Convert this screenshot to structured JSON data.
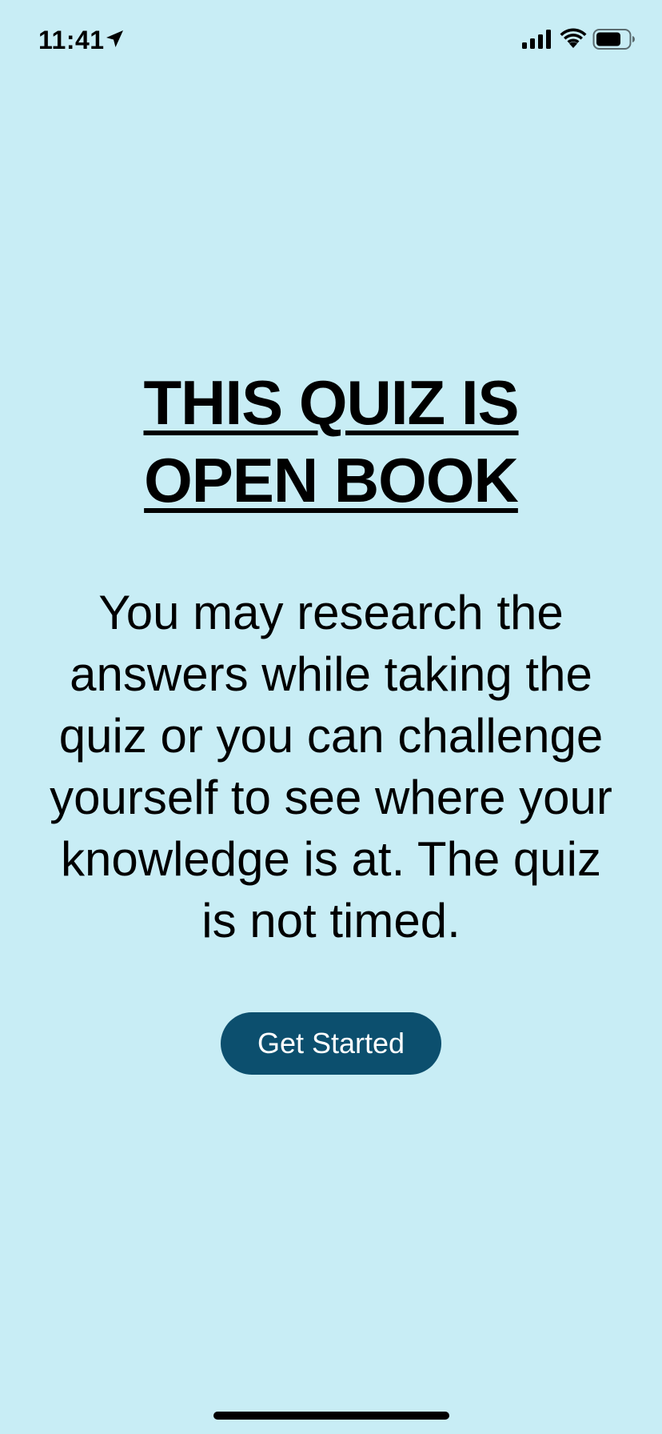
{
  "status_bar": {
    "time": "11:41",
    "icons": [
      "location-arrow-icon",
      "cellular-signal-icon",
      "wifi-icon",
      "battery-icon"
    ]
  },
  "main": {
    "title_line1": "THIS QUIZ IS",
    "title_line2": "OPEN BOOK",
    "description": "You may research the answers while taking the quiz or you can challenge yourself to see where your knowledge is at. The quiz is not timed.",
    "button_label": "Get Started"
  },
  "colors": {
    "background": "#c8edf5",
    "button": "#0c4f6e",
    "button_text": "#ffffff",
    "text": "#000000"
  }
}
